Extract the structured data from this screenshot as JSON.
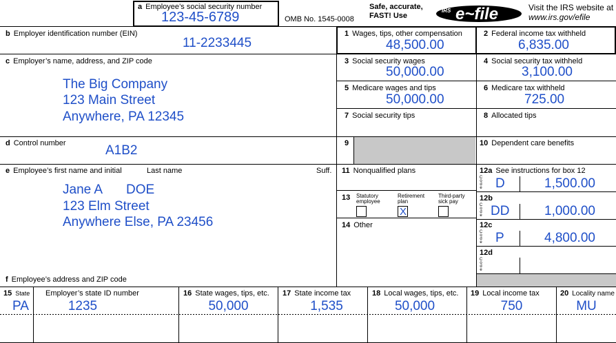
{
  "top": {
    "ssn_label": "Employee’s social security number",
    "ssn_letter": "a",
    "ssn": "123-45-6789",
    "omb": "OMB No. 1545-0008",
    "safe_line1": "Safe, accurate,",
    "safe_line2": "FAST! Use",
    "irs_logo_small": "IRS",
    "efile_logo": "e~file",
    "visit_line1": "Visit the IRS website at",
    "visit_line2": "www.irs.gov/efile"
  },
  "b": {
    "letter": "b",
    "label": "Employer identification number (EIN)",
    "value": "11-2233445"
  },
  "c": {
    "letter": "c",
    "label": "Employer’s name, address, and ZIP code",
    "line1": "The Big Company",
    "line2": "123 Main Street",
    "line3": "Anywhere, PA 12345"
  },
  "d": {
    "letter": "d",
    "label": "Control number",
    "value": "A1B2"
  },
  "e": {
    "letter": "e",
    "label": "Employee’s first name and initial",
    "last_label": "Last name",
    "suff_label": "Suff.",
    "first": "Jane A",
    "last": "DOE",
    "addr1": "123 Elm Street",
    "addr2": "Anywhere Else, PA 23456"
  },
  "f": {
    "letter": "f",
    "label": "Employee’s address and ZIP code"
  },
  "boxes": {
    "b1": {
      "num": "1",
      "label": "Wages, tips, other compensation",
      "value": "48,500.00"
    },
    "b2": {
      "num": "2",
      "label": "Federal income tax withheld",
      "value": "6,835.00"
    },
    "b3": {
      "num": "3",
      "label": "Social security wages",
      "value": "50,000.00"
    },
    "b4": {
      "num": "4",
      "label": "Social security tax withheld",
      "value": "3,100.00"
    },
    "b5": {
      "num": "5",
      "label": "Medicare wages and tips",
      "value": "50,000.00"
    },
    "b6": {
      "num": "6",
      "label": "Medicare tax withheld",
      "value": "725.00"
    },
    "b7": {
      "num": "7",
      "label": "Social security tips"
    },
    "b8": {
      "num": "8",
      "label": "Allocated tips"
    },
    "b9": {
      "num": "9"
    },
    "b10": {
      "num": "10",
      "label": "Dependent care benefits"
    },
    "b11": {
      "num": "11",
      "label": "Nonqualified plans"
    },
    "b12a": {
      "num": "12a",
      "label": "See instructions for box 12",
      "code": "D",
      "amount": "1,500.00"
    },
    "b12b": {
      "num": "12b",
      "code": "DD",
      "amount": "1,000.00"
    },
    "b12c": {
      "num": "12c",
      "code": "P",
      "amount": "4,800.00"
    },
    "b12d": {
      "num": "12d"
    },
    "b13": {
      "num": "13",
      "statutory_1": "Statutory",
      "statutory_2": "employee",
      "retire_1": "Retirement",
      "retire_2": "plan",
      "third_1": "Third-party",
      "third_2": "sick pay",
      "retire_mark": "X"
    },
    "b14": {
      "num": "14",
      "label": "Other"
    },
    "code_letters": [
      "C",
      "o",
      "d",
      "e"
    ]
  },
  "state": {
    "b15": {
      "num": "15",
      "label": "State",
      "value": "PA"
    },
    "state_id": {
      "label": "Employer’s state ID number",
      "value": "1235"
    },
    "b16": {
      "num": "16",
      "label": "State wages, tips, etc.",
      "value": "50,000"
    },
    "b17": {
      "num": "17",
      "label": "State income tax",
      "value": "1,535"
    },
    "b18": {
      "num": "18",
      "label": "Local wages, tips, etc.",
      "value": "50,000"
    },
    "b19": {
      "num": "19",
      "label": "Local income tax",
      "value": "750"
    },
    "b20": {
      "num": "20",
      "label": "Locality name",
      "value": "MU"
    }
  }
}
